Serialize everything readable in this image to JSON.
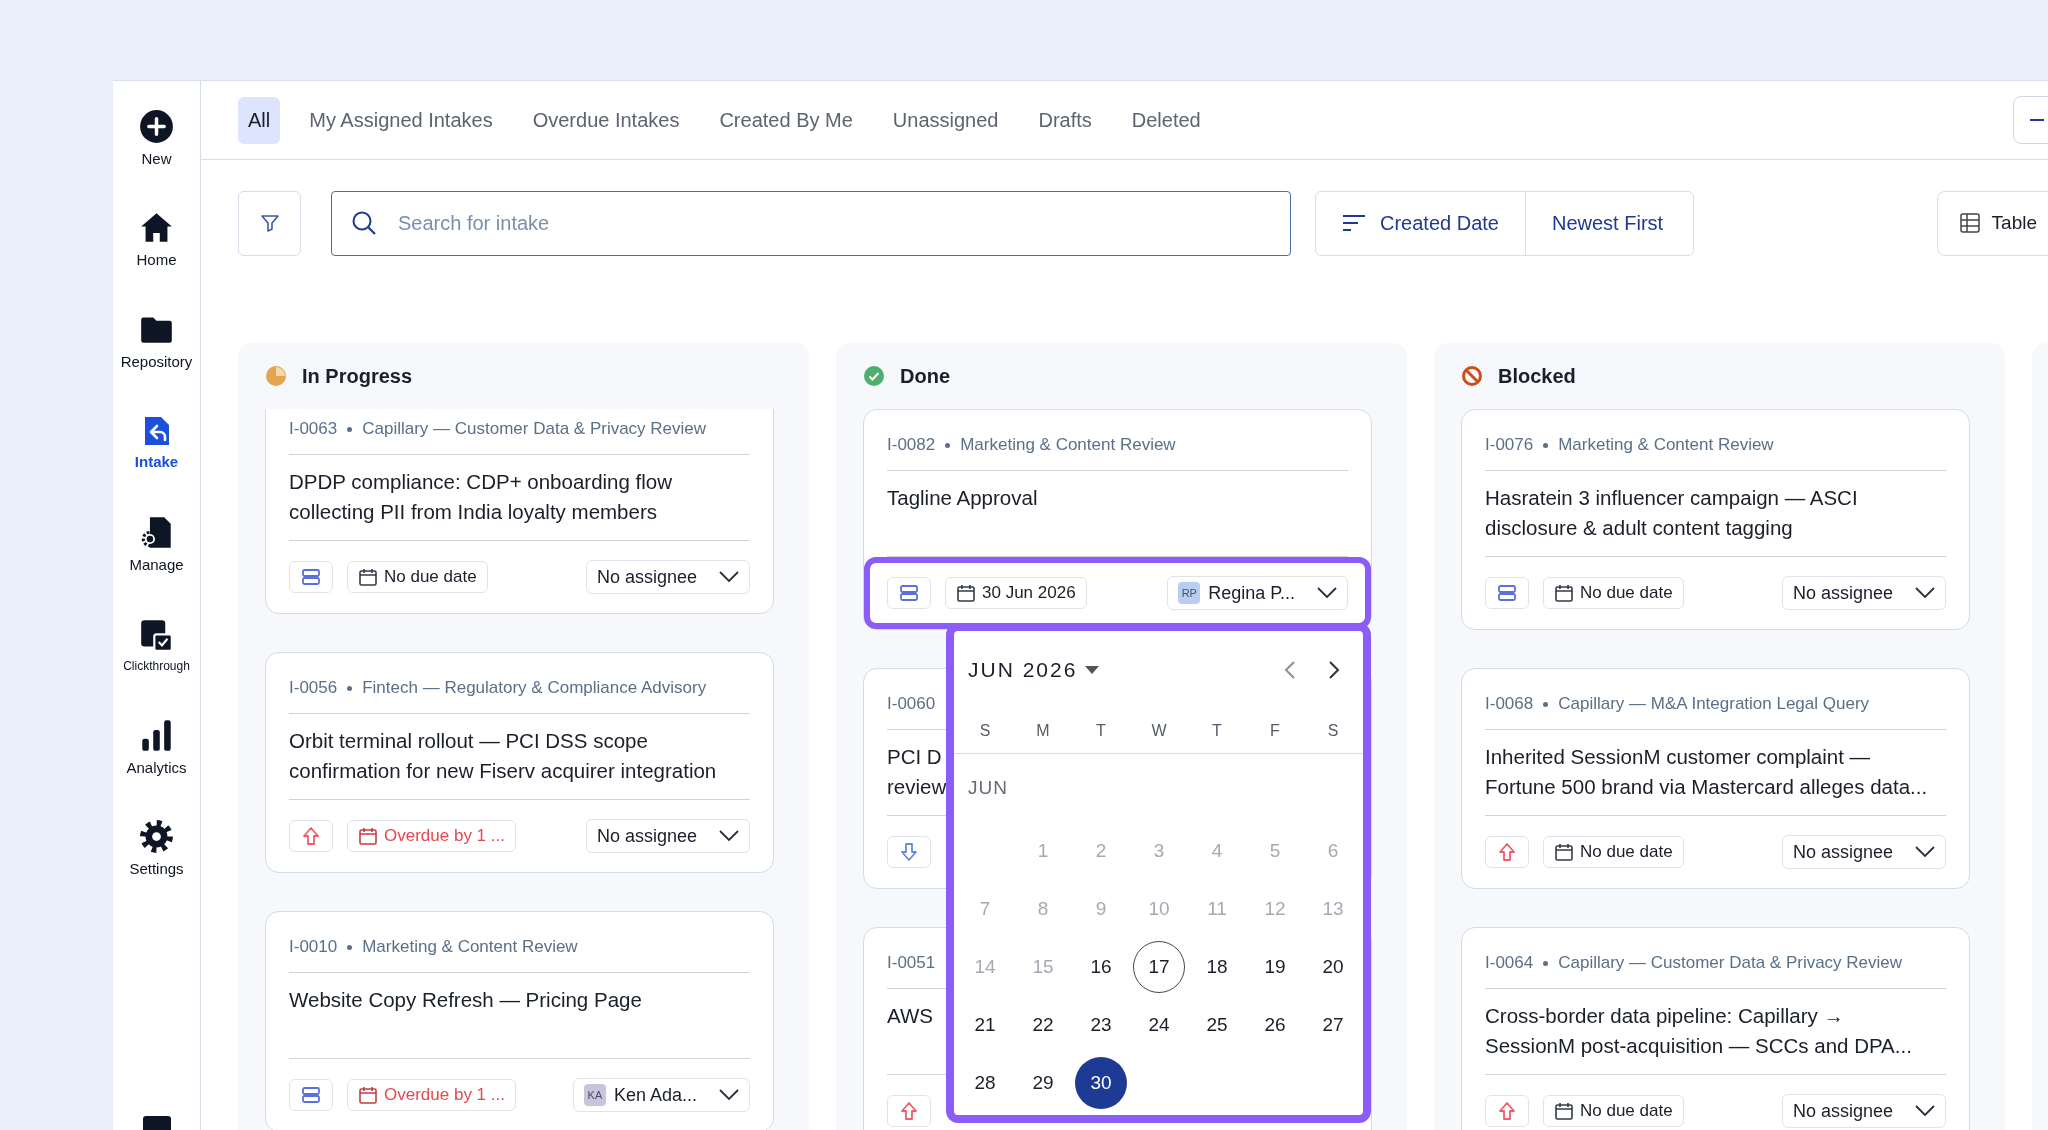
{
  "sidebar": {
    "items": [
      {
        "label": "New",
        "kind": "new",
        "selected": false
      },
      {
        "label": "Home",
        "kind": "home",
        "selected": false
      },
      {
        "label": "Repository",
        "kind": "repository",
        "selected": false
      },
      {
        "label": "Intake",
        "kind": "intake",
        "selected": true
      },
      {
        "label": "Manage",
        "kind": "manage",
        "selected": false
      },
      {
        "label": "Clickthrough",
        "kind": "clickthrough",
        "selected": false
      },
      {
        "label": "Analytics",
        "kind": "analytics",
        "selected": false
      },
      {
        "label": "Settings",
        "kind": "settings",
        "selected": false
      }
    ]
  },
  "tabs": [
    {
      "label": "All",
      "selected": true
    },
    {
      "label": "My Assigned Intakes",
      "selected": false
    },
    {
      "label": "Overdue Intakes",
      "selected": false
    },
    {
      "label": "Created By Me",
      "selected": false
    },
    {
      "label": "Unassigned",
      "selected": false
    },
    {
      "label": "Drafts",
      "selected": false
    },
    {
      "label": "Deleted",
      "selected": false
    }
  ],
  "toolbar": {
    "search": {
      "placeholder": "Search for intake"
    },
    "sort": {
      "field": "Created Date",
      "order": "Newest First"
    },
    "view": {
      "label": "Table"
    }
  },
  "columns": [
    {
      "title": "In Progress",
      "kind": "in_progress",
      "scrolled": true,
      "cards": [
        {
          "id": "I-0063",
          "category": "Capillary — Customer Data & Privacy Review",
          "title": "DPDP compliance: CDP+ onboarding flow\ncollecting PII from India loyalty members",
          "priority": {
            "kind": "medium"
          },
          "due": {
            "text": "No due date",
            "overdue": false
          },
          "assignee": {
            "name": "No assignee"
          }
        },
        {
          "id": "I-0056",
          "category": "Fintech — Regulatory & Compliance Advisory",
          "title": "Orbit terminal rollout — PCI DSS scope\nconfirmation for new Fiserv acquirer integration",
          "priority": {
            "kind": "high"
          },
          "due": {
            "text": "Overdue by 1 ...",
            "overdue": true
          },
          "assignee": {
            "name": "No assignee"
          }
        },
        {
          "id": "I-0010",
          "category": "Marketing & Content Review",
          "title": "Website Copy Refresh — Pricing Page",
          "priority": {
            "kind": "medium"
          },
          "due": {
            "text": "Overdue by 1 ...",
            "overdue": true
          },
          "assignee": {
            "name": "Ken Ada...",
            "initials": "KA",
            "color": "#c8c4dc"
          }
        }
      ]
    },
    {
      "title": "Done",
      "kind": "done",
      "scrolled": false,
      "cards": [
        {
          "id": "I-0082",
          "category": "Marketing & Content Review",
          "title": "Tagline Approval",
          "priority": {
            "kind": "medium"
          },
          "due": {
            "text": "30 Jun 2026",
            "overdue": false
          },
          "assignee": {
            "name": "Regina P...",
            "initials": "RP",
            "color": "#b9cdf0"
          },
          "focused": true,
          "date_picker": {
            "month_label": "JUN 2026",
            "weekdays": [
              "S",
              "M",
              "T",
              "W",
              "T",
              "F",
              "S"
            ],
            "section_label": "JUN",
            "weeks": [
              [
                {
                  "label": "1",
                  "disabled": true,
                  "today": false,
                  "selected": false
                },
                {
                  "label": "2",
                  "disabled": true,
                  "today": false,
                  "selected": false
                },
                {
                  "label": "3",
                  "disabled": true,
                  "today": false,
                  "selected": false
                },
                {
                  "label": "4",
                  "disabled": true,
                  "today": false,
                  "selected": false
                },
                {
                  "label": "5",
                  "disabled": true,
                  "today": false,
                  "selected": false
                },
                {
                  "label": "6",
                  "disabled": true,
                  "today": false,
                  "selected": false
                }
              ],
              [
                {
                  "label": "7",
                  "disabled": true,
                  "today": false,
                  "selected": false
                },
                {
                  "label": "8",
                  "disabled": true,
                  "today": false,
                  "selected": false
                },
                {
                  "label": "9",
                  "disabled": true,
                  "today": false,
                  "selected": false
                },
                {
                  "label": "10",
                  "disabled": true,
                  "today": false,
                  "selected": false
                },
                {
                  "label": "11",
                  "disabled": true,
                  "today": false,
                  "selected": false
                },
                {
                  "label": "12",
                  "disabled": true,
                  "today": false,
                  "selected": false
                },
                {
                  "label": "13",
                  "disabled": true,
                  "today": false,
                  "selected": false
                }
              ],
              [
                {
                  "label": "14",
                  "disabled": true,
                  "today": false,
                  "selected": false
                },
                {
                  "label": "15",
                  "disabled": true,
                  "today": false,
                  "selected": false
                },
                {
                  "label": "16",
                  "disabled": false,
                  "today": false,
                  "selected": false
                },
                {
                  "label": "17",
                  "disabled": false,
                  "today": true,
                  "selected": false
                },
                {
                  "label": "18",
                  "disabled": false,
                  "today": false,
                  "selected": false
                },
                {
                  "label": "19",
                  "disabled": false,
                  "today": false,
                  "selected": false
                },
                {
                  "label": "20",
                  "disabled": false,
                  "today": false,
                  "selected": false
                }
              ],
              [
                {
                  "label": "21",
                  "disabled": false,
                  "today": false,
                  "selected": false
                },
                {
                  "label": "22",
                  "disabled": false,
                  "today": false,
                  "selected": false
                },
                {
                  "label": "23",
                  "disabled": false,
                  "today": false,
                  "selected": false
                },
                {
                  "label": "24",
                  "disabled": false,
                  "today": false,
                  "selected": false
                },
                {
                  "label": "25",
                  "disabled": false,
                  "today": false,
                  "selected": false
                },
                {
                  "label": "26",
                  "disabled": false,
                  "today": false,
                  "selected": false
                },
                {
                  "label": "27",
                  "disabled": false,
                  "today": false,
                  "selected": false
                }
              ],
              [
                {
                  "label": "28",
                  "disabled": false,
                  "today": false,
                  "selected": false
                },
                {
                  "label": "29",
                  "disabled": false,
                  "today": false,
                  "selected": false
                },
                {
                  "label": "30",
                  "disabled": false,
                  "today": false,
                  "selected": true
                }
              ]
            ]
          }
        },
        {
          "id": "I-0060",
          "title": "PCI D\nreview",
          "priority": {
            "kind": "low"
          }
        },
        {
          "id": "I-0051",
          "title": "AWS",
          "priority": {
            "kind": "high"
          }
        }
      ]
    },
    {
      "title": "Blocked",
      "kind": "blocked",
      "scrolled": false,
      "cards": [
        {
          "id": "I-0076",
          "category": "Marketing & Content Review",
          "title": "Hasratein 3 influencer campaign — ASCI\ndisclosure & adult content tagging",
          "priority": {
            "kind": "medium"
          },
          "due": {
            "text": "No due date",
            "overdue": false
          },
          "assignee": {
            "name": "No assignee"
          }
        },
        {
          "id": "I-0068",
          "category": "Capillary — M&A Integration Legal Query",
          "title": "Inherited SessionM customer complaint —\nFortune 500 brand via Mastercard alleges data...",
          "priority": {
            "kind": "high"
          },
          "due": {
            "text": "No due date",
            "overdue": false
          },
          "assignee": {
            "name": "No assignee"
          }
        },
        {
          "id": "I-0064",
          "category": "Capillary — Customer Data & Privacy Review",
          "title": "Cross-border data pipeline: Capillary →\nSessionM post-acquisition — SCCs and DPA...",
          "priority": {
            "kind": "high"
          },
          "due": {
            "text": "No due date",
            "overdue": false
          },
          "assignee": {
            "name": "No assignee"
          }
        }
      ]
    }
  ]
}
